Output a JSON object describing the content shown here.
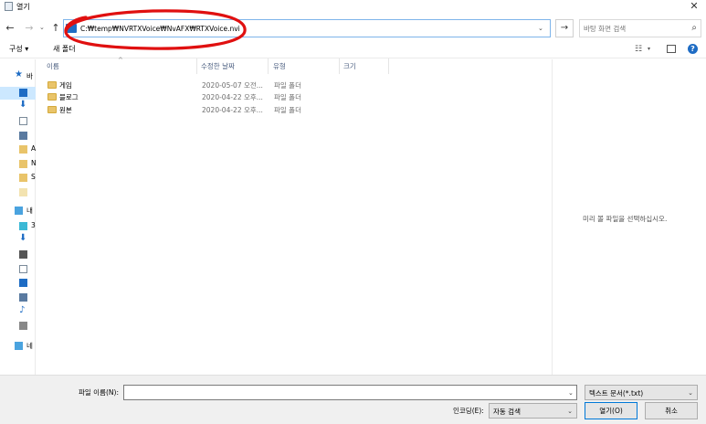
{
  "window": {
    "title": "열기",
    "close_glyph": "✕"
  },
  "nav": {
    "back": "←",
    "forward": "→",
    "dropdown": "⌄",
    "up": "↑"
  },
  "address": {
    "path": "C:₩temp₩NVRTXVoice₩NvAFX₩RTXVoice.nvi",
    "caret": "⌄",
    "go": "→"
  },
  "search": {
    "placeholder": "바탕 화면 검색",
    "icon": "⌕"
  },
  "toolbar": {
    "organize": "구성 ▾",
    "new_folder": "새 폴더",
    "view_icon": "☷",
    "view_caret": "▾",
    "help": "?"
  },
  "navpane": {
    "items": [
      {
        "label": "바",
        "icon": "star-icon",
        "color": "#1e6cc4"
      },
      {
        "label": "",
        "icon": "desktop-icon",
        "color": "#1e6cc4"
      },
      {
        "label": "",
        "icon": "download-icon",
        "color": "#1e6cc4"
      },
      {
        "label": "",
        "icon": "document-icon",
        "color": "#7a8a99"
      },
      {
        "label": "",
        "icon": "picture-icon",
        "color": "#5a7aa0"
      },
      {
        "label": "A",
        "icon": "folder-icon",
        "color": "#e9c46a"
      },
      {
        "label": "N",
        "icon": "folder-icon",
        "color": "#e9c46a"
      },
      {
        "label": "S",
        "icon": "folder-icon",
        "color": "#e9c46a"
      },
      {
        "label": "",
        "icon": "folder-icon",
        "color": "#f3e3b0"
      },
      {
        "label": "내",
        "icon": "pc-icon",
        "color": "#4aa3df"
      },
      {
        "label": "3",
        "icon": "3d-objects-icon",
        "color": "#3cb9d6"
      },
      {
        "label": "",
        "icon": "download-icon",
        "color": "#1e6cc4"
      },
      {
        "label": "",
        "icon": "video-icon",
        "color": "#555555"
      },
      {
        "label": "",
        "icon": "document-icon",
        "color": "#7a8a99"
      },
      {
        "label": "",
        "icon": "desktop-icon",
        "color": "#1e6cc4"
      },
      {
        "label": "",
        "icon": "picture-icon",
        "color": "#5a7aa0"
      },
      {
        "label": "",
        "icon": "music-icon",
        "color": "#1e6cc4"
      },
      {
        "label": "",
        "icon": "drive-icon",
        "color": "#888888"
      },
      {
        "label": "네",
        "icon": "network-icon",
        "color": "#4aa3df"
      }
    ]
  },
  "list": {
    "headers": [
      "이름",
      "수정한 날짜",
      "유형",
      "크기"
    ],
    "sort_arrow": "^",
    "rows": [
      {
        "name": "게임",
        "date": "2020-05-07 오전...",
        "type": "파일 폴더",
        "size": ""
      },
      {
        "name": "블로그",
        "date": "2020-04-22 오후...",
        "type": "파일 폴더",
        "size": ""
      },
      {
        "name": "원본",
        "date": "2020-04-22 오후...",
        "type": "파일 폴더",
        "size": ""
      }
    ]
  },
  "preview": {
    "text": "미리 볼 파일을 선택하십시오."
  },
  "bottom": {
    "filename_label": "파일 이름(N):",
    "filename_value": "",
    "filename_caret": "⌄",
    "filetype": "텍스트 문서(*.txt)",
    "filetype_caret": "⌄",
    "encoding_label": "인코딩(E):",
    "encoding_value": "자동 검색",
    "encoding_caret": "⌄",
    "open": "열기(O)",
    "cancel": "취소"
  },
  "annotation_color": "#e01010"
}
